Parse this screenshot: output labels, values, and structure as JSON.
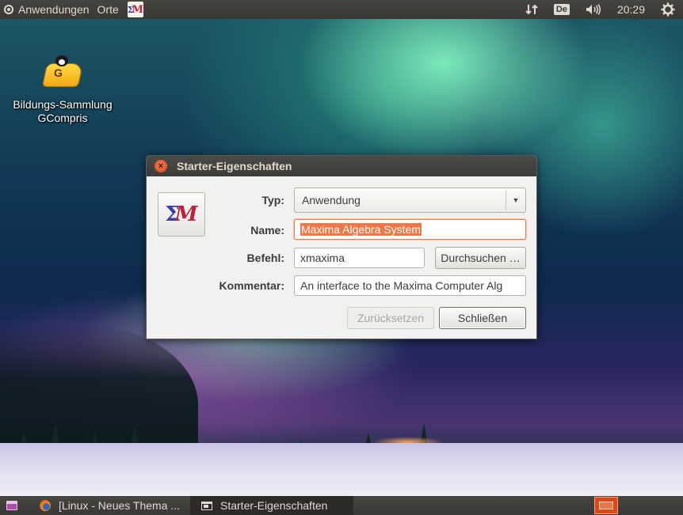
{
  "top_panel": {
    "applications_menu": "Anwendungen",
    "places_menu": "Orte",
    "launcher_icon": "maxima-icon",
    "keyboard_layout": "De",
    "clock": "20:29",
    "icons": [
      "ubuntu-logo-icon",
      "network-icon",
      "volume-icon",
      "gear-icon"
    ]
  },
  "desktop": {
    "icon_label_line1": "Bildungs-Sammlung",
    "icon_label_line2": "GCompris",
    "icon": "gcompris-icon"
  },
  "dialog": {
    "title": "Starter-Eigenschaften",
    "close_icon": "close-icon",
    "type_label": "Typ:",
    "type_value": "Anwendung",
    "name_label": "Name:",
    "name_value": "Maxima Algebra System",
    "command_label": "Befehl:",
    "command_value": "xmaxima",
    "browse_button": "Durchsuchen …",
    "comment_label": "Kommentar:",
    "comment_value": "An interface to the Maxima Computer Alg",
    "revert_button": "Zurücksetzen",
    "close_button": "Schließen",
    "accent_color": "#f07746"
  },
  "bottom_panel": {
    "tasks": [
      {
        "label": "[Linux - Neues Thema ...",
        "icon": "firefox-icon",
        "active": false
      },
      {
        "label": "Starter-Eigenschaften",
        "icon": "window-icon",
        "active": true
      }
    ],
    "show_desktop_icon": "show-desktop-icon",
    "workspace_switcher_icon": "workspace-switcher-icon"
  }
}
